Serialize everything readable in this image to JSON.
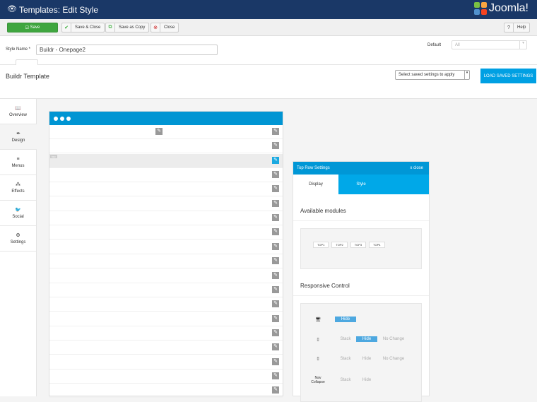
{
  "header": {
    "title": "Templates: Edit Style",
    "logo": "Joomla!"
  },
  "toolbar": {
    "save": "Save",
    "save_close": "Save & Close",
    "save_copy": "Save as Copy",
    "close": "Close",
    "help": "Help"
  },
  "form": {
    "style_name_label": "Style Name *",
    "style_name_value": "Buildr - Onepage2",
    "default_label": "Default",
    "default_value": "All"
  },
  "builder": {
    "title": "Buildr Template",
    "saved_select": "Select saved settings to apply",
    "load_button": "LOAD SAVED SETTINGS",
    "row_tag": "top"
  },
  "sidebar": {
    "items": [
      {
        "label": "Overview",
        "icon": "book-icon"
      },
      {
        "label": "Design",
        "icon": "brush-icon"
      },
      {
        "label": "Menus",
        "icon": "menu-icon"
      },
      {
        "label": "Effects",
        "icon": "effects-icon"
      },
      {
        "label": "Social",
        "icon": "twitter-icon"
      },
      {
        "label": "Settings",
        "icon": "gear-icon"
      }
    ]
  },
  "panel": {
    "title": "Top Row Settings",
    "close": "x close",
    "tabs": [
      "Display",
      "Style"
    ],
    "available_modules": "Available modules",
    "modules": [
      "TOP1",
      "TOP2",
      "TOP3",
      "TOP4"
    ],
    "responsive": "Responsive Control",
    "rows": [
      {
        "device": "desktop",
        "options": [
          {
            "label": "Hide",
            "active": true
          }
        ]
      },
      {
        "device": "tablet",
        "options": [
          {
            "label": "Stack",
            "active": false
          },
          {
            "label": "Hide",
            "active": true
          },
          {
            "label": "No Change",
            "active": false
          }
        ]
      },
      {
        "device": "phone",
        "options": [
          {
            "label": "Stack",
            "active": false
          },
          {
            "label": "Hide",
            "active": false
          },
          {
            "label": "No Change",
            "active": false
          }
        ]
      },
      {
        "device": "Nav Collapse",
        "options": [
          {
            "label": "Stack",
            "active": false
          },
          {
            "label": "Hide",
            "active": false
          }
        ]
      }
    ]
  },
  "colors": {
    "header": "#1a3867",
    "accent": "#00a0e3",
    "save": "#3fa63f"
  }
}
